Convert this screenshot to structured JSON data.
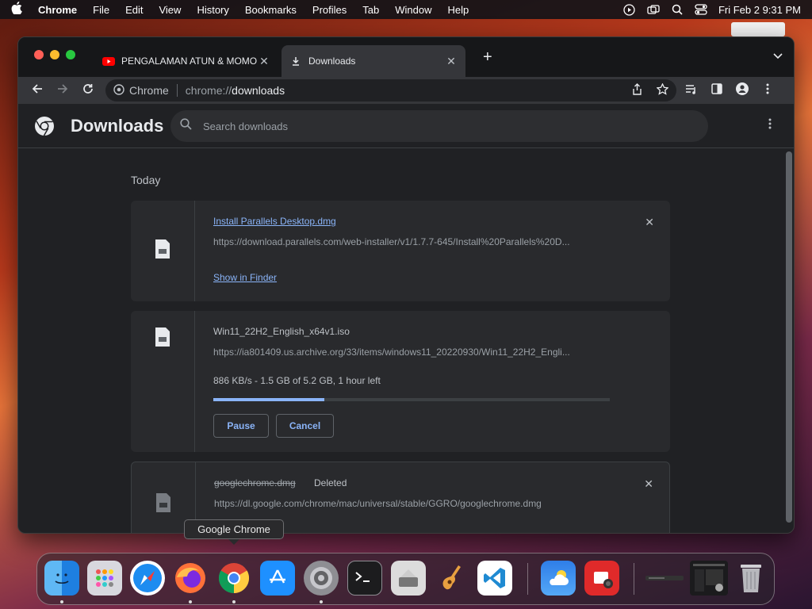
{
  "menubar": {
    "app": "Chrome",
    "items": [
      "File",
      "Edit",
      "View",
      "History",
      "Bookmarks",
      "Profiles",
      "Tab",
      "Window",
      "Help"
    ],
    "clock": "Fri Feb 2  9:31 PM"
  },
  "tabs": [
    {
      "title": "PENGALAMAN ATUN & MOMO",
      "icon": "youtube-icon"
    },
    {
      "title": "Downloads",
      "icon": "download-icon"
    }
  ],
  "toolbar": {
    "site_chip": "Chrome",
    "url_scheme": "chrome://",
    "url_host": "downloads"
  },
  "downloads_page": {
    "title": "Downloads",
    "search_placeholder": "Search downloads",
    "day_label": "Today",
    "items": [
      {
        "filename": "Install Parallels Desktop.dmg",
        "url": "https://download.parallels.com/web-installer/v1/1.7.7-645/Install%20Parallels%20D...",
        "action": "Show in Finder"
      },
      {
        "filename": "Win11_22H2_English_x64v1.iso",
        "url": "https://ia801409.us.archive.org/33/items/windows11_20220930/Win11_22H2_Engli...",
        "status": "886 KB/s - 1.5 GB of 5.2 GB, 1 hour left",
        "progress": 0.28,
        "pause": "Pause",
        "cancel": "Cancel"
      },
      {
        "filename": "googlechrome.dmg",
        "state": "Deleted",
        "url": "https://dl.google.com/chrome/mac/universal/stable/GGRO/googlechrome.dmg"
      }
    ]
  },
  "dock": {
    "tooltip": "Google Chrome",
    "apps": [
      "Finder",
      "Launchpad",
      "Safari",
      "Firefox",
      "Google Chrome",
      "App Store",
      "System Settings",
      "Terminal",
      "Boot Camp Assistant",
      "GarageBand",
      "Visual Studio Code",
      "Weather",
      "Photo Booth",
      "Trash"
    ]
  },
  "colors": {
    "accent": "#8ab4f8",
    "window_bg": "#202124",
    "card_bg": "#292a2d"
  }
}
